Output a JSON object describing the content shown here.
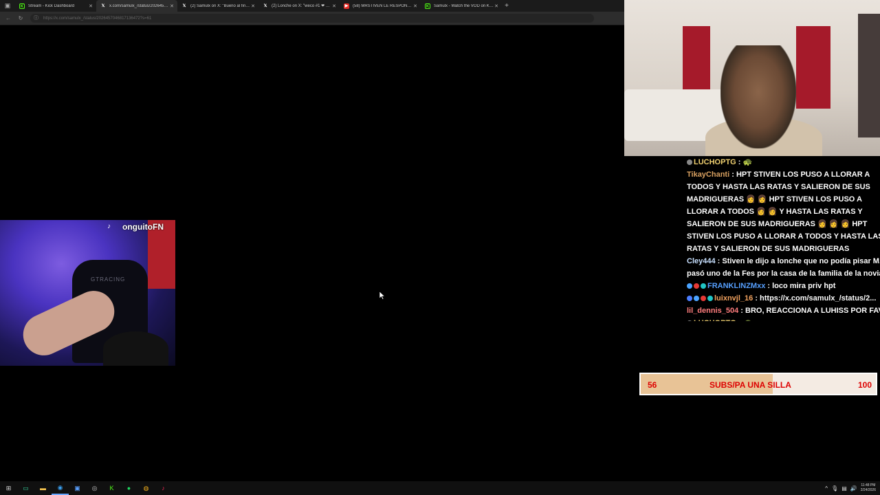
{
  "browser": {
    "tabs": [
      {
        "icon": "kick",
        "title": "Stream - Kick Dashboard"
      },
      {
        "icon": "x",
        "title": "x.com/samulx_/status/2026457046817..."
      },
      {
        "icon": "x",
        "title": "(2) Samulx on X: \"Bueno al final t..."
      },
      {
        "icon": "x",
        "title": "(2) Lonche on X: \"weco #1 ❤ D ..."
      },
      {
        "icon": "yt",
        "title": "(58) MRSTIVEN LE RESPONDE A V..."
      },
      {
        "icon": "kick",
        "title": "Samulx - Watch the VOD on Kick"
      }
    ],
    "active_tab_index": 1,
    "url": "https://x.com/samulx_/status/2026457046817136472?s=61"
  },
  "game_cam": {
    "handle": "onguitoFN",
    "chair_logo": "GTRACING"
  },
  "chat": [
    {
      "user": "LUCHOPTG",
      "text": "🐢",
      "cls": "u1",
      "badges": [
        "#888888"
      ]
    },
    {
      "user": "TikayChanti",
      "text": "HPT STIVEN LOS PUSO A LLORAR A TODOS Y HASTA LAS RATAS Y SALIERON DE SUS MADRIGUERAS 👩 👩 HPT STIVEN LOS PUSO A LLORAR A TODOS 👩 👩 Y HASTA LAS RATAS Y SALIERON DE SUS MADRIGUERAS 👩 👩 👩 HPT STIVEN LOS PUSO A LLORAR A TODOS Y HASTA LAS RATAS Y SALIERON DE SUS MADRIGUERAS",
      "cls": "u2",
      "badges": []
    },
    {
      "user": "Cley444",
      "text": "Stiven le dijo a lonche que no podía pisar M... pasó uno de la Fes por la casa de la familia de la novia",
      "cls": "u3",
      "badges": []
    },
    {
      "user": "FRANKLINZMxx",
      "text": "loco mira priv hpt",
      "cls": "u4",
      "badges": [
        "#4aa3ff",
        "#e53935",
        "#21c6c6"
      ]
    },
    {
      "user": "luixnvjl_16",
      "text": "https://x.com/samulx_/status/2...",
      "cls": "u5",
      "badges": [
        "#4a7dff",
        "#4aa3ff",
        "#e53935",
        "#21c6c6"
      ]
    },
    {
      "user": "lil_dennis_504",
      "text": "BRO, REACCIONA A LUHISS POR FAVOR",
      "cls": "u6",
      "badges": []
    },
    {
      "user": "LUCHOPTG",
      "text": "🐢",
      "cls": "u1",
      "badges": [
        "#888888"
      ]
    }
  ],
  "goal": {
    "current": "56",
    "label": "SUBS/PA UNA SILLA",
    "max": "100",
    "progress_fraction": 0.56
  },
  "taskbar": {
    "icons": [
      "windows-start-icon",
      "terminal-icon",
      "file-explorer-icon",
      "edge-browser-icon",
      "store-icon",
      "obs-icon",
      "kick-icon",
      "spotify-icon",
      "chrome-icon",
      "tiktok-icon"
    ],
    "time": "11:48 PM",
    "date": "2/24/2026"
  }
}
